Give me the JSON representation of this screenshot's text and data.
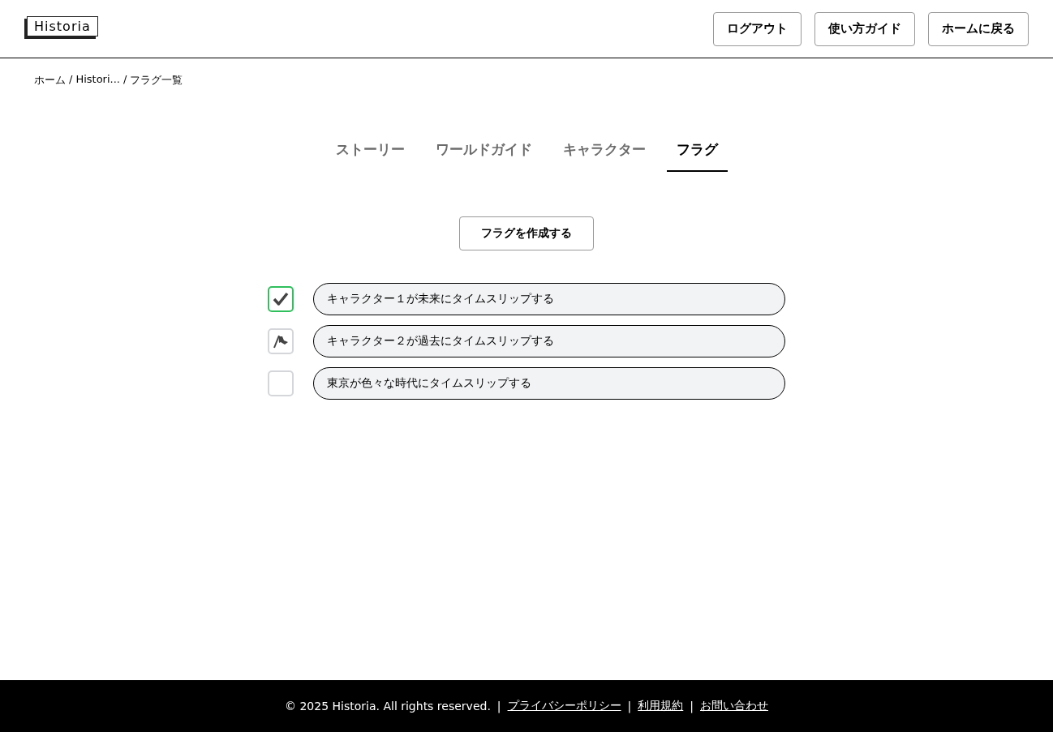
{
  "header": {
    "logo": "Historia",
    "buttons": [
      "ログアウト",
      "使い方ガイド",
      "ホームに戻る"
    ]
  },
  "breadcrumb": [
    "ホーム",
    "/",
    "Histori...",
    "/",
    "フラグ一覧"
  ],
  "tabs": [
    {
      "label": "ストーリー",
      "selected": false
    },
    {
      "label": "ワールドガイド",
      "selected": false
    },
    {
      "label": "キャラクター",
      "selected": false
    },
    {
      "label": "フラグ",
      "selected": true
    }
  ],
  "create_button": "フラグを作成する",
  "flags": [
    {
      "label": "キャラクター１が未来にタイムスリップする",
      "checked": true,
      "flagged": false
    },
    {
      "label": "キャラクター２が過去にタイムスリップする",
      "checked": false,
      "flagged": true
    },
    {
      "label": "東京が色々な時代にタイムスリップする",
      "checked": false,
      "flagged": false
    }
  ],
  "footer": {
    "copyright": "© 2025 Historia. All rights reserved.",
    "links": [
      {
        "kind": "sep",
        "label": "|"
      },
      {
        "kind": "link",
        "label": "プライバシーポリシー"
      },
      {
        "kind": "sep",
        "label": "|"
      },
      {
        "kind": "link",
        "label": "利用規約"
      },
      {
        "kind": "sep",
        "label": "|"
      },
      {
        "kind": "link",
        "label": "お問い合わせ"
      }
    ]
  }
}
